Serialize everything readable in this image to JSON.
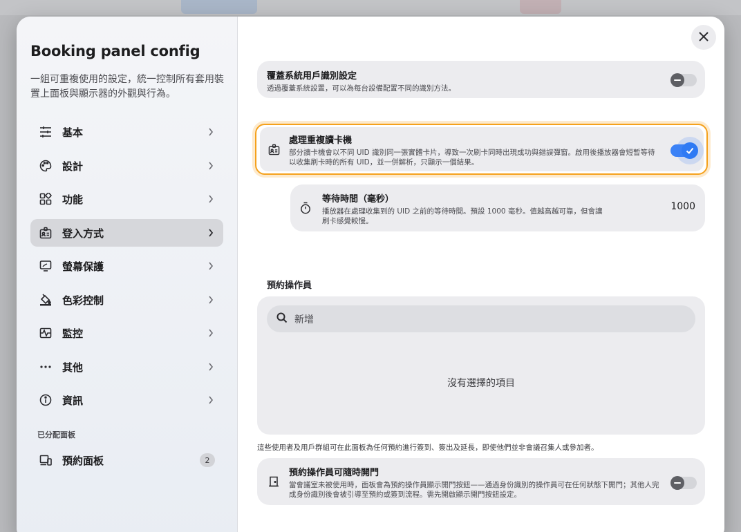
{
  "sidebar": {
    "title": "Booking panel config",
    "description": "一組可重複使用的設定，統一控制所有套用裝置上面板與顯示器的外觀與行為。",
    "items": [
      {
        "label": "基本",
        "icon": "sliders-icon"
      },
      {
        "label": "設計",
        "icon": "palette-icon"
      },
      {
        "label": "功能",
        "icon": "widgets-icon"
      },
      {
        "label": "登入方式",
        "icon": "badge-icon"
      },
      {
        "label": "螢幕保護",
        "icon": "screensaver-icon"
      },
      {
        "label": "色彩控制",
        "icon": "paint-bucket-icon"
      },
      {
        "label": "監控",
        "icon": "monitoring-icon"
      },
      {
        "label": "其他",
        "icon": "more-icon"
      },
      {
        "label": "資訊",
        "icon": "info-icon"
      }
    ],
    "active_index": 3,
    "section_label": "已分配面板",
    "assigned": {
      "label": "預約面板",
      "count": "2",
      "icon": "devices-icon"
    }
  },
  "main": {
    "override_identification": {
      "title": "覆蓋系統用戶識別設定",
      "description": "透過覆蓋系統設置，可以為每台設備配置不同的識別方法。",
      "enabled": false
    },
    "duplicate_reader": {
      "title": "處理重複讀卡機",
      "description": "部分讀卡機會以不同 UID 識別同一張實體卡片，導致一次刷卡同時出現成功與錯誤彈窗。啟用後播放器會短暫等待以收集刷卡時的所有 UID，並一併解析，只顯示一個結果。",
      "enabled": true
    },
    "wait_time": {
      "title": "等待時間（毫秒）",
      "description": "播放器在處理收集到的 UID 之前的等待時間。預設 1000 毫秒。值越高越可靠，但會讓刷卡感覺較慢。",
      "value": "1000"
    },
    "operators": {
      "section_label": "預約操作員",
      "search_placeholder": "新增",
      "empty_text": "沒有選擇的項目",
      "note": "這些使用者及用戶群組可在此面板為任何預約進行簽到、簽出及延長，即使他們並非會議召集人或參加者。"
    },
    "open_door": {
      "title": "預約操作員可隨時開門",
      "description": "當會議室未被使用時，面板會為預約操作員顯示開門按鈕——通過身份識別的操作員可在任何狀態下開門；其他人完成身份識別後會被引導至預約或簽到流程。需先開啟顯示開門按鈕設定。",
      "enabled": false
    }
  },
  "colors": {
    "accent": "#3b82f6",
    "highlight": "#f5a11c"
  }
}
